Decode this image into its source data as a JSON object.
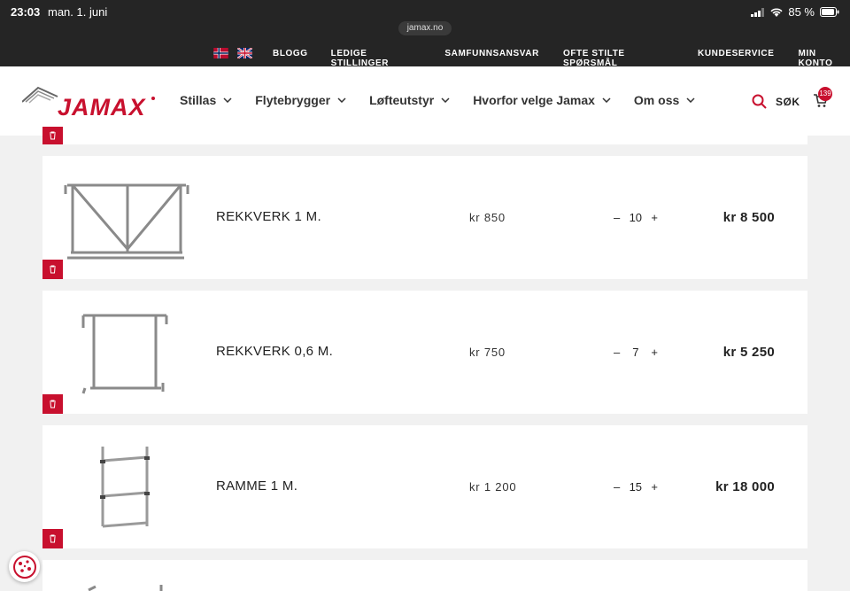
{
  "status": {
    "time": "23:03",
    "date": "man. 1. juni",
    "battery": "85 %"
  },
  "browser": {
    "url": "jamax.no"
  },
  "topnav": [
    "BLOGG",
    "LEDIGE STILLINGER",
    "SAMFUNNSANSVAR",
    "OFTE STILTE SPØRSMÅL",
    "KUNDESERVICE",
    "MIN KONTO"
  ],
  "header": {
    "logo_text": "JAMAX",
    "nav": [
      "Stillas",
      "Flytebrygger",
      "Løfteutstyr",
      "Hvorfor velge Jamax",
      "Om oss"
    ],
    "search_label": "SØK",
    "cart_count": "139"
  },
  "cart": {
    "items": [
      {
        "name": "REKKVERK 1 M.",
        "price": "kr 850",
        "qty": "10",
        "total": "kr 8 500"
      },
      {
        "name": "REKKVERK 0,6 M.",
        "price": "kr 750",
        "qty": "7",
        "total": "kr 5 250"
      },
      {
        "name": "RAMME 1 M.",
        "price": "kr 1 200",
        "qty": "15",
        "total": "kr 18 000"
      }
    ],
    "minus": "–",
    "plus": "+"
  },
  "colors": {
    "brand": "#c8102e",
    "topbar": "#252525"
  }
}
